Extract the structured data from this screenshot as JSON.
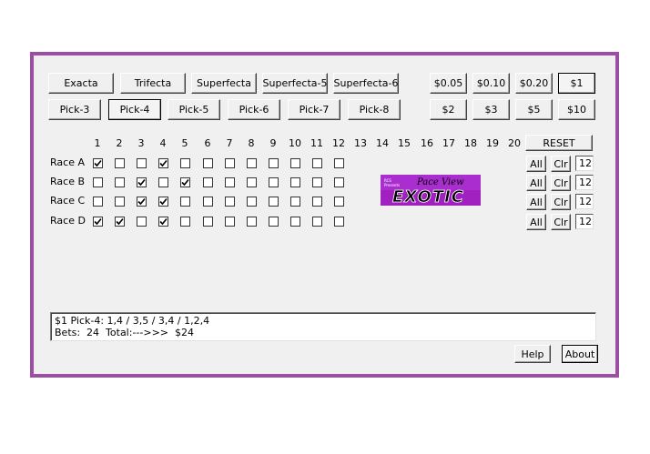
{
  "bet_types": [
    "Exacta",
    "Trifecta",
    "Superfecta",
    "Superfecta-5",
    "Superfecta-6"
  ],
  "pick_types": [
    "Pick-3",
    "Pick-4",
    "Pick-5",
    "Pick-6",
    "Pick-7",
    "Pick-8"
  ],
  "selected_pick": "Pick-4",
  "amounts_row1": [
    "$0.05",
    "$0.10",
    "$0.20",
    "$1"
  ],
  "amounts_row2": [
    "$2",
    "$3",
    "$5",
    "$10"
  ],
  "selected_amount": "$1",
  "columns": [
    "1",
    "2",
    "3",
    "4",
    "5",
    "6",
    "7",
    "8",
    "9",
    "10",
    "11",
    "12",
    "13",
    "14",
    "15",
    "16",
    "17",
    "18",
    "19",
    "20"
  ],
  "reset_label": "RESET",
  "races": [
    {
      "label": "Race A",
      "checked": [
        true,
        false,
        false,
        true,
        false,
        false,
        false,
        false,
        false,
        false,
        false,
        false
      ],
      "all_label": "All",
      "clr_label": "Clr",
      "count": "12"
    },
    {
      "label": "Race B",
      "checked": [
        false,
        false,
        true,
        false,
        true,
        false,
        false,
        false,
        false,
        false,
        false,
        false
      ],
      "all_label": "All",
      "clr_label": "Clr",
      "count": "12"
    },
    {
      "label": "Race C",
      "checked": [
        false,
        false,
        true,
        true,
        false,
        false,
        false,
        false,
        false,
        false,
        false,
        false
      ],
      "all_label": "All",
      "clr_label": "Clr",
      "count": "12"
    },
    {
      "label": "Race D",
      "checked": [
        true,
        true,
        false,
        true,
        false,
        false,
        false,
        false,
        false,
        false,
        false,
        false
      ],
      "all_label": "All",
      "clr_label": "Clr",
      "count": "12"
    }
  ],
  "logo": {
    "top_text": "Pace View",
    "main_text": "EXOTIC",
    "small_text": "RCS Presents",
    "bg_color": "#a020c0"
  },
  "output": {
    "line1": "$1 Pick-4: 1,4 / 3,5 / 3,4 / 1,2,4",
    "line2": "Bets:  24  Total:--->>>  $24"
  },
  "help_label": "Help",
  "about_label": "About"
}
